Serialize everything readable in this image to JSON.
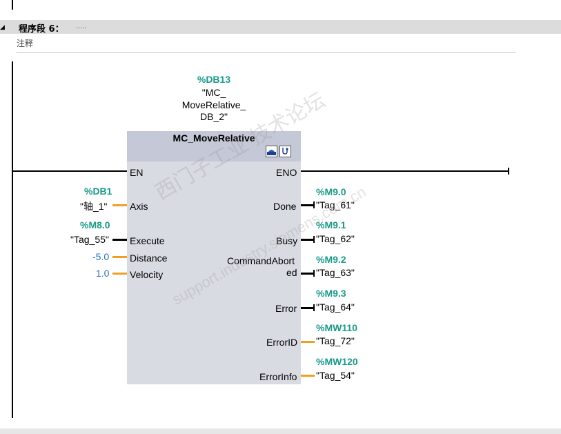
{
  "segment": {
    "title": "程序段 6：",
    "dots": "....."
  },
  "comment": "注释",
  "instance": {
    "db": "%DB13",
    "name_line1": "\"MC_",
    "name_line2": "MoveRelative_",
    "name_line3": "DB_2\""
  },
  "block": {
    "title": "MC_MoveRelative"
  },
  "inputs": {
    "en": "EN",
    "axis": {
      "pin": "Axis",
      "addr": "%DB1",
      "tag": "\"轴_1\""
    },
    "execute": {
      "pin": "Execute",
      "addr": "%M8.0",
      "tag": "\"Tag_55\""
    },
    "distance": {
      "pin": "Distance",
      "value": "-5.0"
    },
    "velocity": {
      "pin": "Velocity",
      "value": "1.0"
    }
  },
  "outputs": {
    "eno": "ENO",
    "done": {
      "pin": "Done",
      "addr": "%M9.0",
      "tag": "\"Tag_61\""
    },
    "busy": {
      "pin": "Busy",
      "addr": "%M9.1",
      "tag": "\"Tag_62\""
    },
    "aborted": {
      "pin_line1": "CommandAbort",
      "pin_line2": "ed",
      "addr": "%M9.2",
      "tag": "\"Tag_63\""
    },
    "error": {
      "pin": "Error",
      "addr": "%M9.3",
      "tag": "\"Tag_64\""
    },
    "errorid": {
      "pin": "ErrorID",
      "addr": "%MW110",
      "tag": "\"Tag_72\""
    },
    "errorinfo": {
      "pin": "ErrorInfo",
      "addr": "%MW120",
      "tag": "\"Tag_54\""
    }
  },
  "watermark": {
    "text1": "西门子工业 技术论坛",
    "text2": "support.industry.siemens.com.cn"
  },
  "colors": {
    "address": "#1a9a8a",
    "constant": "#2a6fbf",
    "wire_data": "#f0a020",
    "block": "#d9dbe3"
  },
  "icons": [
    "monitor-icon",
    "diagnostic-icon"
  ]
}
